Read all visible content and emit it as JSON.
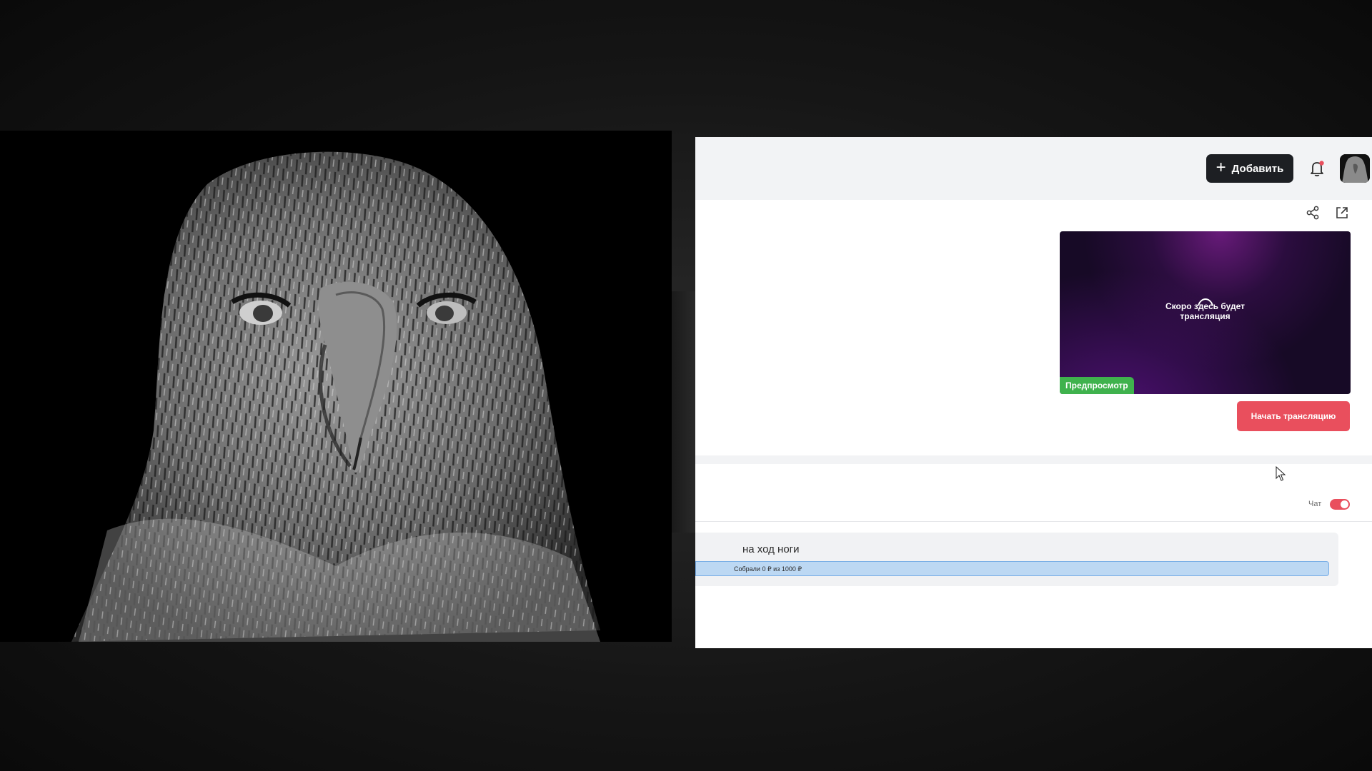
{
  "header": {
    "add_button_label": "Добавить",
    "icons": [
      "plus-icon",
      "bell-icon",
      "avatar"
    ]
  },
  "stream": {
    "preview_text_line1": "Скоро здесь будет",
    "preview_text_line2": "трансляция",
    "preview_badge": "Предпросмотр",
    "start_button_label": "Начать трансляцию",
    "icons": [
      "share-icon",
      "external-link-icon"
    ]
  },
  "chat": {
    "label": "Чат",
    "enabled": true
  },
  "goal": {
    "title": "на ход ноги",
    "progress_text": "Собрали 0 ₽ из 1000 ₽",
    "collected": 0,
    "target": 1000
  },
  "colors": {
    "accent_red": "#e94f5d",
    "badge_green": "#3fb24d",
    "dark_button": "#1d1f23",
    "progress_fill": "#bcd8f3"
  }
}
